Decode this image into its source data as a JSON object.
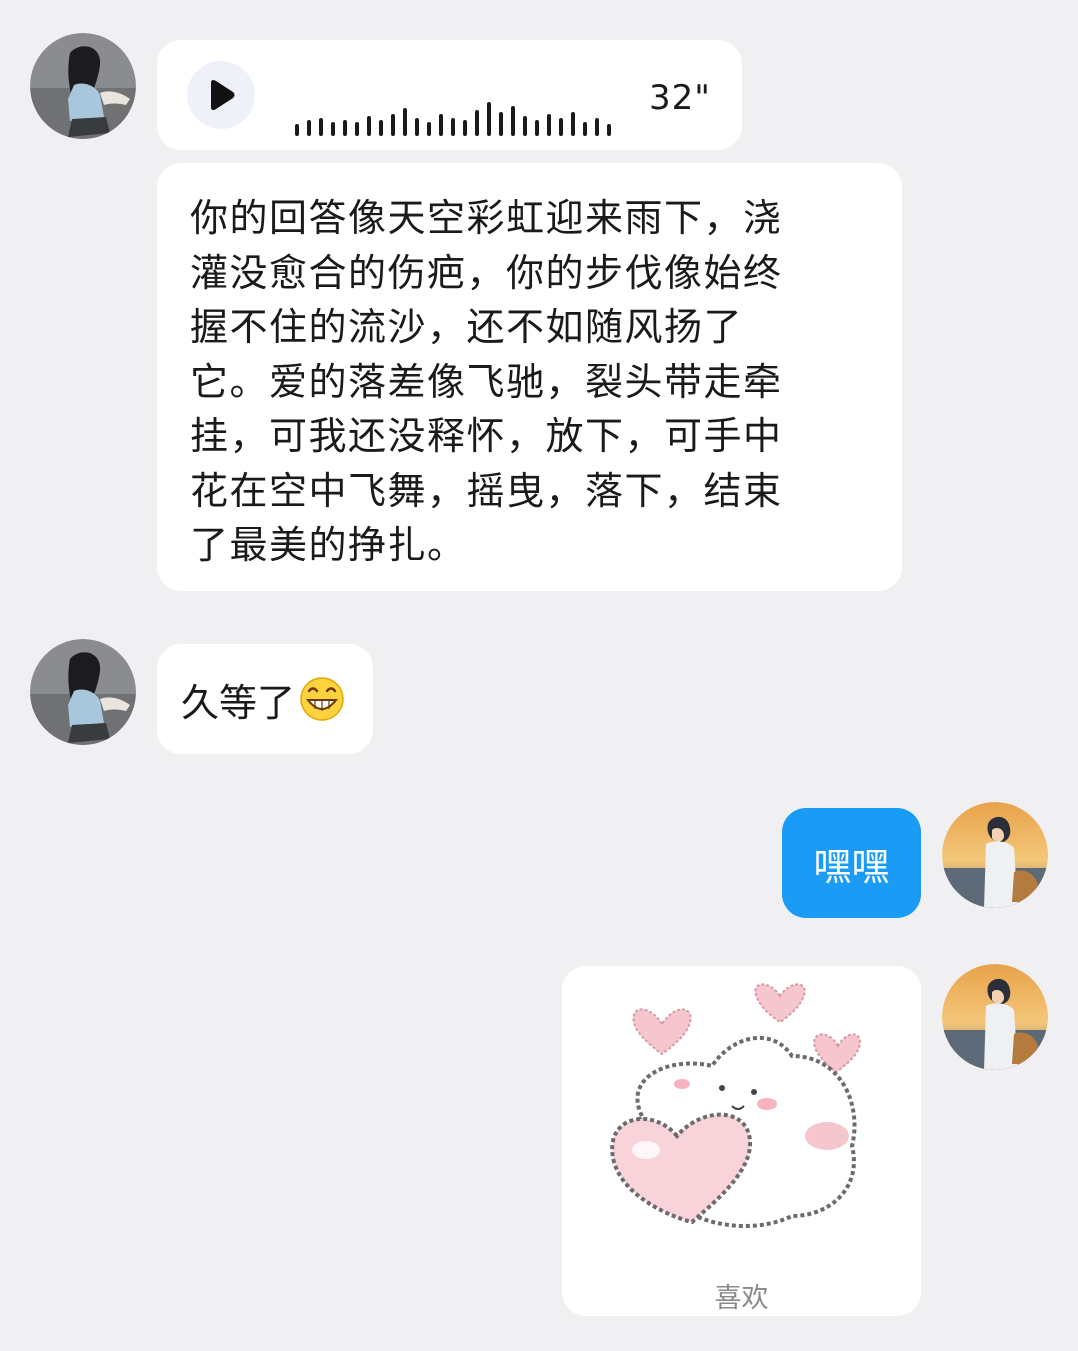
{
  "messages": {
    "voice": {
      "duration": "32\""
    },
    "text_long": "你的回答像天空彩虹迎来雨下，浇\n灌没愈合的伤疤，你的步伐像始终\n握不住的流沙，还不如随风扬了\n它。爱的落差像飞驰，裂头带走牵\n挂，可我还没释怀，放下，可手中\n花在空中飞舞，摇曳，落下，结束\n了最美的挣扎。",
    "text_short": "久等了",
    "outgoing_text": "嘿嘿",
    "sticker_label": "喜欢"
  },
  "colors": {
    "background": "#f0f0f3",
    "incoming_bubble": "#ffffff",
    "outgoing_bubble": "#1a9bf6",
    "sticker_pink": "#f6c6cf"
  },
  "icons": {
    "play": "play-icon",
    "emoji": "grinning-face-emoji"
  }
}
